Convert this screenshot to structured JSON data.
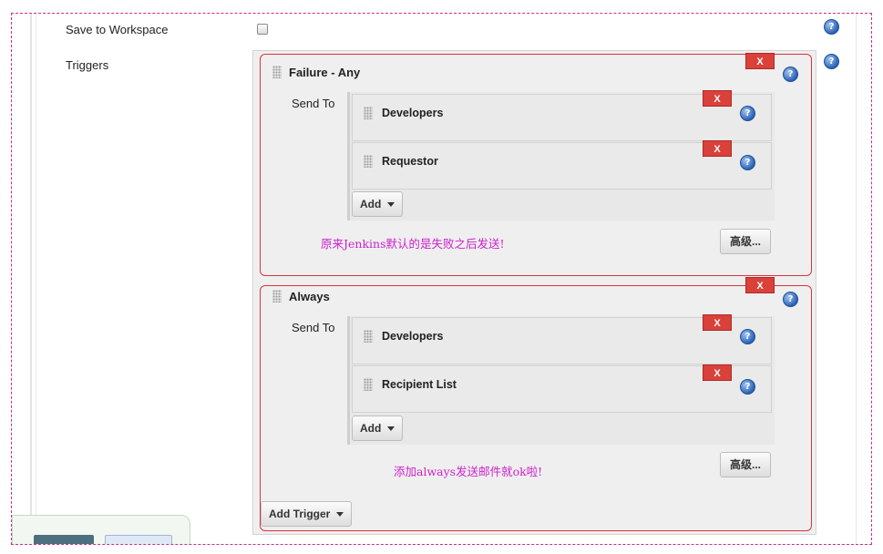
{
  "save_to_workspace": {
    "label": "Save to Workspace",
    "checked": false
  },
  "triggers": {
    "label": "Triggers",
    "items": [
      {
        "title": "Failure - Any",
        "send_to_label": "Send To",
        "recipients": [
          "Developers",
          "Requestor"
        ],
        "add_label": "Add",
        "advanced_label": "高级...",
        "note": "原来Jenkins默认的是失败之后发送!"
      },
      {
        "title": "Always",
        "send_to_label": "Send To",
        "recipients": [
          "Developers",
          "Recipient List"
        ],
        "add_label": "Add",
        "advanced_label": "高级...",
        "note": "添加always发送邮件就ok啦!"
      }
    ],
    "add_trigger_label": "Add Trigger"
  },
  "delete_label": "X",
  "icons": {
    "help": "help-icon",
    "delete": "close-icon",
    "drag": "drag-handle-icon",
    "dropdown": "caret-down-icon"
  },
  "colors": {
    "annotation_border": "#d9343c",
    "delete_button": "#d9413a",
    "note_text": "#cc22cc",
    "frame_border": "#cc2d8a",
    "help_icon": "#2c62b4"
  }
}
